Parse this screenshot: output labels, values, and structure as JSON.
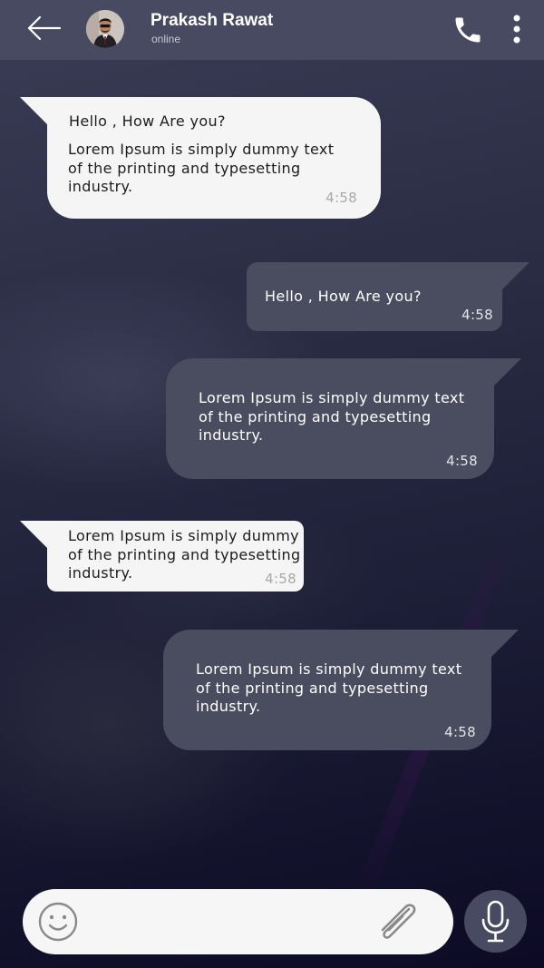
{
  "header": {
    "contact_name": "Prakash Rawat",
    "status": "online"
  },
  "icons": {
    "back": "arrow-left-icon",
    "call": "phone-icon",
    "more": "more-vertical-icon",
    "emoji": "smiley-icon",
    "attach": "paperclip-icon",
    "mic": "microphone-icon"
  },
  "messages": [
    {
      "direction": "incoming",
      "greeting": "Hello , How Are you?",
      "text": "Lorem Ipsum is simply dummy text\nof the printing and typesetting\nindustry.",
      "time": "4:58"
    },
    {
      "direction": "outgoing",
      "text": "Hello , How Are you?",
      "time": "4:58"
    },
    {
      "direction": "outgoing",
      "text": "Lorem Ipsum is simply dummy text\nof the printing and typesetting\nindustry.",
      "time": "4:58"
    },
    {
      "direction": "incoming",
      "text": "Lorem Ipsum is simply dummy\nof the printing and typesetting\nindustry.",
      "time": "4:58"
    },
    {
      "direction": "outgoing",
      "text": "Lorem Ipsum is simply dummy text\nof the printing and typesetting\nindustry.",
      "time": "4:58"
    }
  ],
  "composer": {
    "value": "",
    "placeholder": ""
  },
  "colors": {
    "header_bg": "#474a61",
    "incoming_bubble": "#f5f5f5",
    "outgoing_bubble": "#4a4c60",
    "mic_button": "#474a61"
  }
}
